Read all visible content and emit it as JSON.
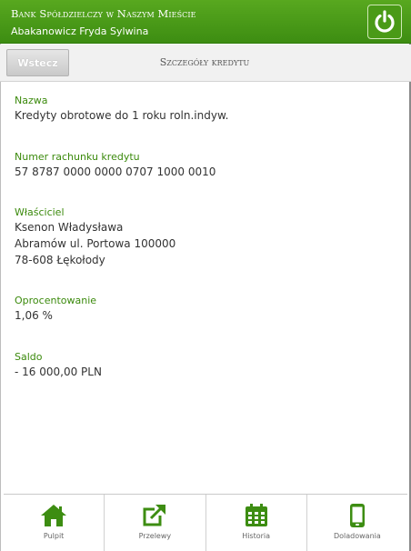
{
  "header": {
    "bank_name": "Bank Spółdzielczy w Naszym Mieście",
    "user_name": "Abakanowicz Fryda Sylwina",
    "logout_icon": "power-icon"
  },
  "toolbar": {
    "back_label": "Wstecz",
    "title": "Szczegóły kredytu"
  },
  "details": {
    "name": {
      "label": "Nazwa",
      "value": "Kredyty obrotowe do 1 roku roln.indyw."
    },
    "account": {
      "label": "Numer rachunku kredytu",
      "value": "57 8787 0000 0000 0707 1000 0010"
    },
    "owner": {
      "label": "Właściciel",
      "name": "Ksenon Władysława",
      "street": "Abramów ul. Portowa 100000",
      "city": "78-608 Łękołody"
    },
    "interest": {
      "label": "Oprocentowanie",
      "value": "1,06 %"
    },
    "balance": {
      "label": "Saldo",
      "value": "- 16 000,00 PLN"
    }
  },
  "nav": {
    "items": [
      {
        "label": "Pulpit",
        "icon": "home-icon"
      },
      {
        "label": "Przelewy",
        "icon": "transfer-icon"
      },
      {
        "label": "Historia",
        "icon": "calendar-icon"
      },
      {
        "label": "Doladowania",
        "icon": "phone-icon"
      }
    ]
  },
  "colors": {
    "accent": "#3d8d12",
    "label": "#3b8a0c",
    "text": "#333333"
  }
}
